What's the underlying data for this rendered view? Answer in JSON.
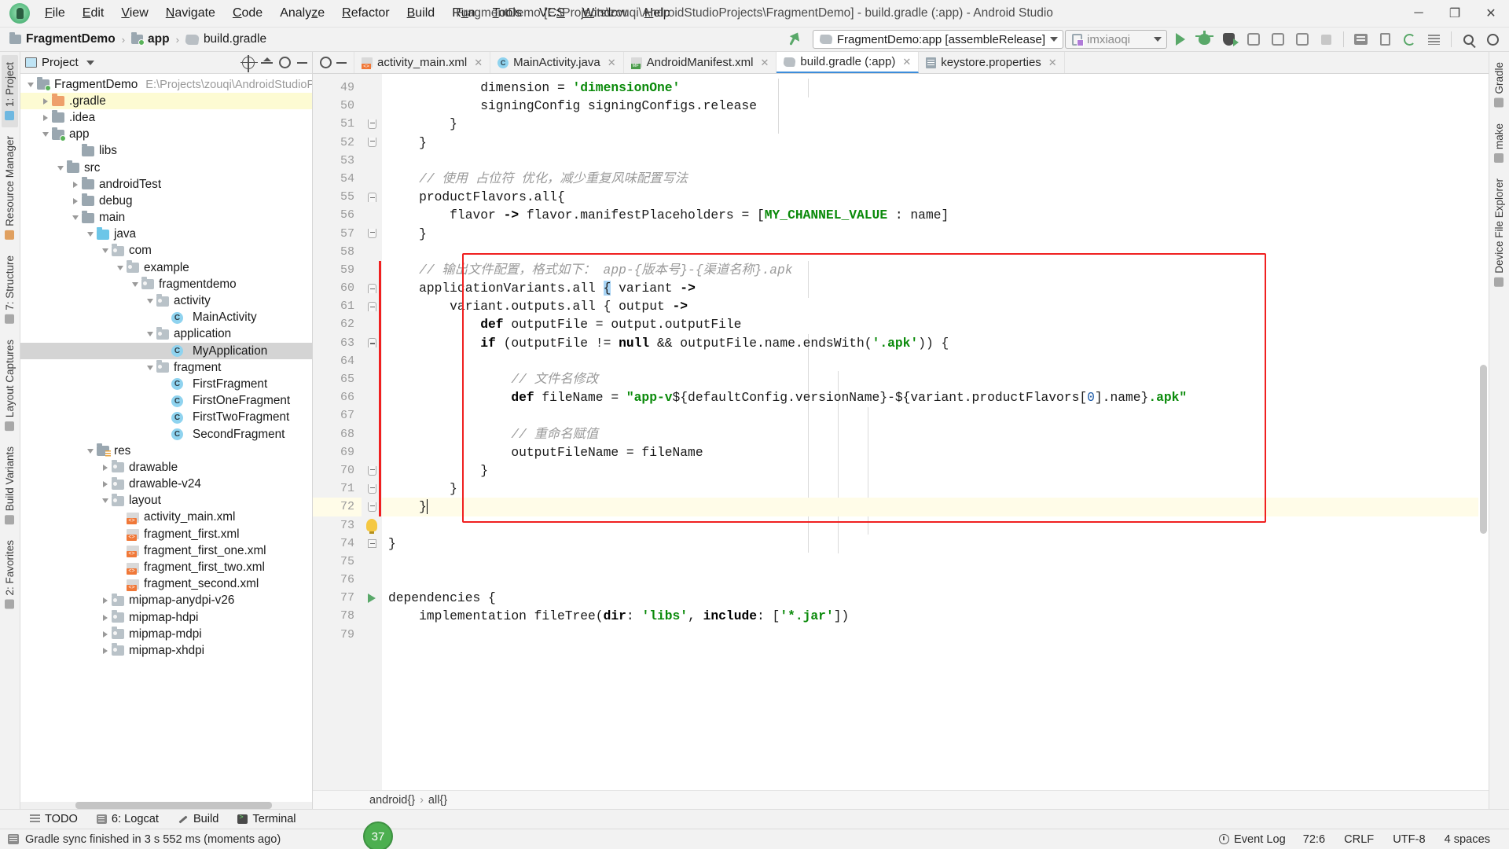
{
  "titlebar": {
    "menus": [
      {
        "pre": "",
        "u": "F",
        "post": "ile"
      },
      {
        "pre": "",
        "u": "E",
        "post": "dit"
      },
      {
        "pre": "",
        "u": "V",
        "post": "iew"
      },
      {
        "pre": "",
        "u": "N",
        "post": "avigate"
      },
      {
        "pre": "",
        "u": "C",
        "post": "ode"
      },
      {
        "pre": "Analy",
        "u": "z",
        "post": "e"
      },
      {
        "pre": "",
        "u": "R",
        "post": "efactor"
      },
      {
        "pre": "",
        "u": "B",
        "post": "uild"
      },
      {
        "pre": "R",
        "u": "u",
        "post": "n"
      },
      {
        "pre": "",
        "u": "T",
        "post": "ools"
      },
      {
        "pre": "VC",
        "u": "S",
        "post": ""
      },
      {
        "pre": "",
        "u": "W",
        "post": "indow"
      },
      {
        "pre": "",
        "u": "H",
        "post": "elp"
      }
    ],
    "window_title": "FragmentDemo [E:\\Projects\\zouqi\\AndroidStudioProjects\\FragmentDemo] - build.gradle (:app) - Android Studio",
    "minimize": "─",
    "maximize": "❐",
    "close": "✕"
  },
  "navbar": {
    "breadcrumbs": [
      "FragmentDemo",
      "app",
      "build.gradle"
    ],
    "separator": "›",
    "run_config": "FragmentDemo:app [assembleRelease]",
    "device": "imxiaoqi"
  },
  "project_panel": {
    "title": "Project",
    "tree": [
      {
        "depth": 0,
        "twisty": "down",
        "icon": "folder-module",
        "label": "FragmentDemo",
        "path": "E:\\Projects\\zouqi\\AndroidStudioProject",
        "state": ""
      },
      {
        "depth": 1,
        "twisty": "right",
        "icon": "folder-orange",
        "label": ".gradle",
        "path": "",
        "state": "hl-yellow"
      },
      {
        "depth": 1,
        "twisty": "right",
        "icon": "folder",
        "label": ".idea",
        "path": "",
        "state": ""
      },
      {
        "depth": 1,
        "twisty": "down",
        "icon": "folder-module",
        "label": "app",
        "path": "",
        "state": ""
      },
      {
        "depth": 3,
        "twisty": "none",
        "icon": "folder",
        "label": "libs",
        "path": "",
        "state": ""
      },
      {
        "depth": 2,
        "twisty": "down",
        "icon": "folder",
        "label": "src",
        "path": "",
        "state": ""
      },
      {
        "depth": 3,
        "twisty": "right",
        "icon": "folder",
        "label": "androidTest",
        "path": "",
        "state": ""
      },
      {
        "depth": 3,
        "twisty": "right",
        "icon": "folder",
        "label": "debug",
        "path": "",
        "state": ""
      },
      {
        "depth": 3,
        "twisty": "down",
        "icon": "folder",
        "label": "main",
        "path": "",
        "state": ""
      },
      {
        "depth": 4,
        "twisty": "down",
        "icon": "folder-blue",
        "label": "java",
        "path": "",
        "state": ""
      },
      {
        "depth": 5,
        "twisty": "down",
        "icon": "pkg",
        "label": "com",
        "path": "",
        "state": ""
      },
      {
        "depth": 6,
        "twisty": "down",
        "icon": "pkg",
        "label": "example",
        "path": "",
        "state": ""
      },
      {
        "depth": 7,
        "twisty": "down",
        "icon": "pkg",
        "label": "fragmentdemo",
        "path": "",
        "state": ""
      },
      {
        "depth": 8,
        "twisty": "down",
        "icon": "pkg",
        "label": "activity",
        "path": "",
        "state": ""
      },
      {
        "depth": 9,
        "twisty": "none",
        "icon": "class",
        "label": "MainActivity",
        "path": "",
        "state": ""
      },
      {
        "depth": 8,
        "twisty": "down",
        "icon": "pkg",
        "label": "application",
        "path": "",
        "state": ""
      },
      {
        "depth": 9,
        "twisty": "none",
        "icon": "class",
        "label": "MyApplication",
        "path": "",
        "state": "sel"
      },
      {
        "depth": 8,
        "twisty": "down",
        "icon": "pkg",
        "label": "fragment",
        "path": "",
        "state": ""
      },
      {
        "depth": 9,
        "twisty": "none",
        "icon": "class",
        "label": "FirstFragment",
        "path": "",
        "state": ""
      },
      {
        "depth": 9,
        "twisty": "none",
        "icon": "class",
        "label": "FirstOneFragment",
        "path": "",
        "state": ""
      },
      {
        "depth": 9,
        "twisty": "none",
        "icon": "class",
        "label": "FirstTwoFragment",
        "path": "",
        "state": ""
      },
      {
        "depth": 9,
        "twisty": "none",
        "icon": "class",
        "label": "SecondFragment",
        "path": "",
        "state": ""
      },
      {
        "depth": 4,
        "twisty": "down",
        "icon": "res",
        "label": "res",
        "path": "",
        "state": ""
      },
      {
        "depth": 5,
        "twisty": "right",
        "icon": "pkg",
        "label": "drawable",
        "path": "",
        "state": ""
      },
      {
        "depth": 5,
        "twisty": "right",
        "icon": "pkg",
        "label": "drawable-v24",
        "path": "",
        "state": ""
      },
      {
        "depth": 5,
        "twisty": "down",
        "icon": "pkg",
        "label": "layout",
        "path": "",
        "state": ""
      },
      {
        "depth": 6,
        "twisty": "none",
        "icon": "xml",
        "label": "activity_main.xml",
        "path": "",
        "state": ""
      },
      {
        "depth": 6,
        "twisty": "none",
        "icon": "xml",
        "label": "fragment_first.xml",
        "path": "",
        "state": ""
      },
      {
        "depth": 6,
        "twisty": "none",
        "icon": "xml",
        "label": "fragment_first_one.xml",
        "path": "",
        "state": ""
      },
      {
        "depth": 6,
        "twisty": "none",
        "icon": "xml",
        "label": "fragment_first_two.xml",
        "path": "",
        "state": ""
      },
      {
        "depth": 6,
        "twisty": "none",
        "icon": "xml",
        "label": "fragment_second.xml",
        "path": "",
        "state": ""
      },
      {
        "depth": 5,
        "twisty": "right",
        "icon": "pkg",
        "label": "mipmap-anydpi-v26",
        "path": "",
        "state": ""
      },
      {
        "depth": 5,
        "twisty": "right",
        "icon": "pkg",
        "label": "mipmap-hdpi",
        "path": "",
        "state": ""
      },
      {
        "depth": 5,
        "twisty": "right",
        "icon": "pkg",
        "label": "mipmap-mdpi",
        "path": "",
        "state": ""
      },
      {
        "depth": 5,
        "twisty": "right",
        "icon": "pkg",
        "label": "mipmap-xhdpi",
        "path": "",
        "state": ""
      }
    ]
  },
  "left_strip": [
    {
      "label": "1: Project",
      "selected": true,
      "icon": "blue"
    },
    {
      "label": "Resource Manager",
      "selected": false,
      "icon": "orange"
    },
    {
      "label": "7: Structure",
      "selected": false,
      "icon": "gray"
    },
    {
      "label": "Layout Captures",
      "selected": false,
      "icon": "gray"
    },
    {
      "label": "Build Variants",
      "selected": false,
      "icon": "gray"
    },
    {
      "label": "2: Favorites",
      "selected": false,
      "icon": "gray"
    }
  ],
  "right_strip": [
    {
      "label": "Gradle",
      "icon": "gray"
    },
    {
      "label": "make",
      "icon": "gray"
    },
    {
      "label": "Device File Explorer",
      "icon": "gray"
    }
  ],
  "editor": {
    "tabs": [
      {
        "label": "activity_main.xml",
        "icon": "xml",
        "active": false,
        "close": "✕"
      },
      {
        "label": "MainActivity.java",
        "icon": "java",
        "active": false,
        "close": "✕"
      },
      {
        "label": "AndroidManifest.xml",
        "icon": "mf",
        "active": false,
        "close": "✕"
      },
      {
        "label": "build.gradle (:app)",
        "icon": "gradle",
        "active": true,
        "close": "✕"
      },
      {
        "label": "keystore.properties",
        "icon": "prop",
        "active": false,
        "close": "✕"
      }
    ],
    "first_line_number": 49,
    "lines": [
      {
        "n": 49,
        "html": "            dimension = <span class=\"str\">'dimensionOne'</span>"
      },
      {
        "n": 50,
        "html": "            signingConfig signingConfigs.release"
      },
      {
        "n": 51,
        "html": "        }"
      },
      {
        "n": 52,
        "html": "    }"
      },
      {
        "n": 53,
        "html": ""
      },
      {
        "n": 54,
        "html": "    <span class=\"cmt\">// 使用 占位符 优化，减少重复风味配置写法</span>"
      },
      {
        "n": 55,
        "html": "    productFlavors.all{"
      },
      {
        "n": 56,
        "html": "        flavor <span class=\"kw\">-&gt;</span> flavor.manifestPlaceholders = [<span class=\"str\">MY_CHANNEL_VALUE</span> : name]"
      },
      {
        "n": 57,
        "html": "    }"
      },
      {
        "n": 58,
        "html": ""
      },
      {
        "n": 59,
        "html": "    <span class=\"cmt\">// 输出文件配置，格式如下： app-{版本号}-{渠道名称}.apk</span>"
      },
      {
        "n": 60,
        "html": "    applicationVariants.all <span class=\"sel-hl\">{</span> variant <span class=\"kw\">-&gt;</span>"
      },
      {
        "n": 61,
        "html": "        variant.outputs.all { output <span class=\"kw\">-&gt;</span>"
      },
      {
        "n": 62,
        "html": "            <span class=\"kw\">def</span> outputFile = output.outputFile"
      },
      {
        "n": 63,
        "html": "            <span class=\"kw\">if</span> (outputFile != <span class=\"kw\">null</span> &amp;&amp; outputFile.name.endsWith(<span class=\"str\">'.apk'</span>)) {"
      },
      {
        "n": 64,
        "html": ""
      },
      {
        "n": 65,
        "html": "                <span class=\"cmt\">// 文件名修改</span>"
      },
      {
        "n": 66,
        "html": "                <span class=\"kw\">def</span> fileName = <span class=\"str\">\"app-v</span>${defaultConfig.versionName}-${variant.productFlavors[<span class=\"num\">0</span>].name}<span class=\"str\">.apk\"</span>"
      },
      {
        "n": 67,
        "html": ""
      },
      {
        "n": 68,
        "html": "                <span class=\"cmt\">// 重命名赋值</span>"
      },
      {
        "n": 69,
        "html": "                outputFileName = fileName"
      },
      {
        "n": 70,
        "html": "            }"
      },
      {
        "n": 71,
        "html": "        }"
      },
      {
        "n": 72,
        "html": "    }<span style=\"border-left:1.5px solid #000;\"></span>",
        "current": true
      },
      {
        "n": 73,
        "html": ""
      },
      {
        "n": 74,
        "html": "}"
      },
      {
        "n": 75,
        "html": ""
      },
      {
        "n": 76,
        "html": ""
      },
      {
        "n": 77,
        "html": "dependencies {"
      },
      {
        "n": 78,
        "html": "    implementation fileTree(<span class=\"kw\">dir</span>: <span class=\"str\">'libs'</span>, <span class=\"kw\">include</span>: [<span class=\"str\">'*.jar'</span>])"
      },
      {
        "n": 79,
        "html": ""
      }
    ],
    "breadcrumb": [
      "android{}",
      "all{}"
    ],
    "breadcrumb_sep": "›",
    "annotation_color": "#f02020"
  },
  "bottom_tabs": [
    {
      "label": "TODO",
      "icon": "todo"
    },
    {
      "label": "6: Logcat",
      "icon": "logcat"
    },
    {
      "label": "Build",
      "icon": "build"
    },
    {
      "label": "Terminal",
      "icon": "term"
    }
  ],
  "statusbar": {
    "message": "Gradle sync finished in 3 s 552 ms (moments ago)",
    "notification_count": "37",
    "caret": "72:6",
    "line_sep": "CRLF",
    "encoding": "UTF-8",
    "indent": "4 spaces",
    "event_log": "Event Log"
  }
}
